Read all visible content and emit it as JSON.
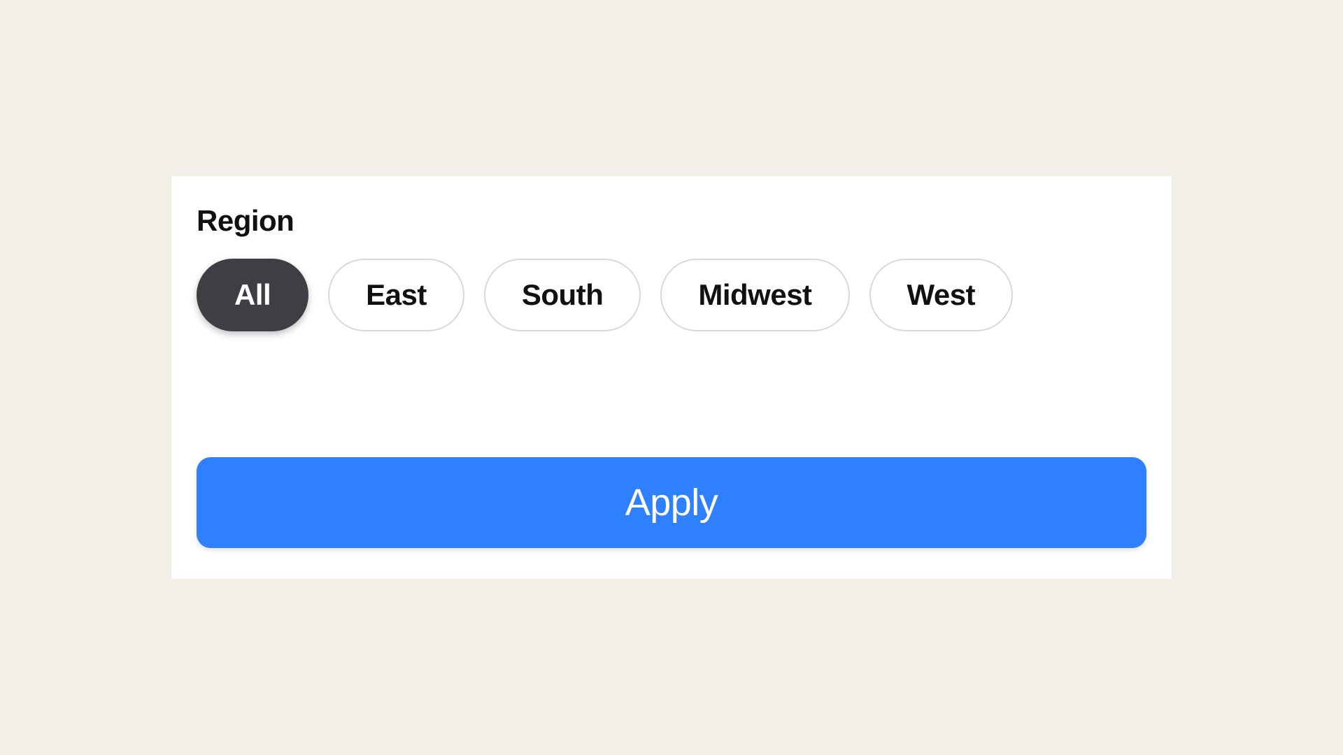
{
  "filter": {
    "title": "Region",
    "options": [
      {
        "label": "All",
        "selected": true
      },
      {
        "label": "East",
        "selected": false
      },
      {
        "label": "South",
        "selected": false
      },
      {
        "label": "Midwest",
        "selected": false
      },
      {
        "label": "West",
        "selected": false
      }
    ],
    "apply_label": "Apply"
  }
}
